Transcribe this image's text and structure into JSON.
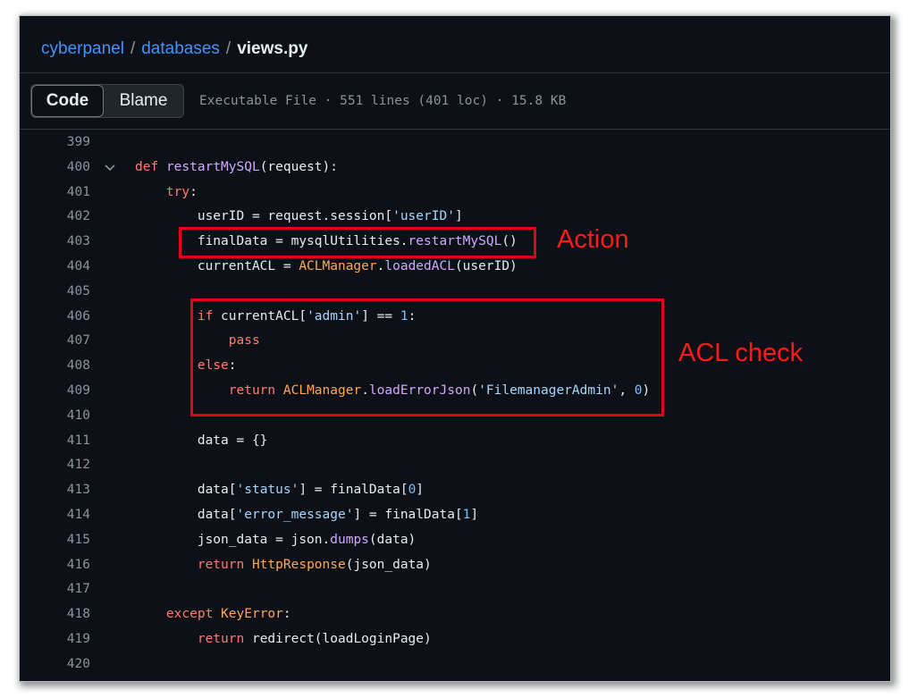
{
  "breadcrumb": {
    "repo": "cyberpanel",
    "separator": "/",
    "folder": "databases",
    "file": "views.py"
  },
  "toolbar": {
    "code_label": "Code",
    "blame_label": "Blame",
    "file_info": "Executable File · 551 lines (401 loc) · 15.8 KB"
  },
  "code": {
    "lines": [
      {
        "n": "399",
        "text": ""
      },
      {
        "n": "400",
        "text": "def restartMySQL(request):"
      },
      {
        "n": "401",
        "text": "    try:"
      },
      {
        "n": "402",
        "text": "        userID = request.session['userID']"
      },
      {
        "n": "403",
        "text": "        finalData = mysqlUtilities.restartMySQL()"
      },
      {
        "n": "404",
        "text": "        currentACL = ACLManager.loadedACL(userID)"
      },
      {
        "n": "405",
        "text": ""
      },
      {
        "n": "406",
        "text": "        if currentACL['admin'] == 1:"
      },
      {
        "n": "407",
        "text": "            pass"
      },
      {
        "n": "408",
        "text": "        else:"
      },
      {
        "n": "409",
        "text": "            return ACLManager.loadErrorJson('FilemanagerAdmin', 0)"
      },
      {
        "n": "410",
        "text": ""
      },
      {
        "n": "411",
        "text": "        data = {}"
      },
      {
        "n": "412",
        "text": ""
      },
      {
        "n": "413",
        "text": "        data['status'] = finalData[0]"
      },
      {
        "n": "414",
        "text": "        data['error_message'] = finalData[1]"
      },
      {
        "n": "415",
        "text": "        json_data = json.dumps(data)"
      },
      {
        "n": "416",
        "text": "        return HttpResponse(json_data)"
      },
      {
        "n": "417",
        "text": ""
      },
      {
        "n": "418",
        "text": "    except KeyError:"
      },
      {
        "n": "419",
        "text": "        return redirect(loadLoginPage)"
      },
      {
        "n": "420",
        "text": ""
      }
    ]
  },
  "annotations": {
    "action_label": "Action",
    "acl_label": "ACL check",
    "color": "#e3001b"
  },
  "icons": {
    "fold": "chevron-down-icon"
  }
}
